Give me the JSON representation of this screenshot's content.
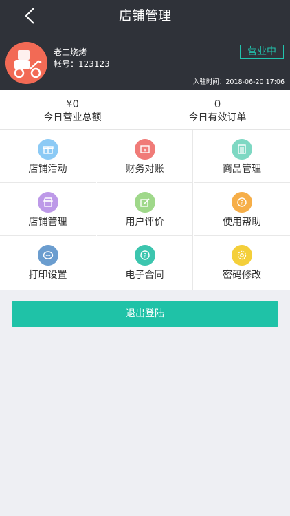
{
  "header": {
    "title": "店铺管理",
    "shop_name": "老三烧烤",
    "account": "帐号：123123",
    "status": "营业中",
    "join_time": "入驻时间：2018-06-20 17:06"
  },
  "stats": {
    "revenue_value": "¥0",
    "revenue_label": "今日营业总额",
    "orders_value": "0",
    "orders_label": "今日有效订单"
  },
  "menu": [
    {
      "label": "店铺活动",
      "icon": "gift-icon",
      "color": "#8ccaf5"
    },
    {
      "label": "财务对账",
      "icon": "finance-icon",
      "color": "#f07b78"
    },
    {
      "label": "商品管理",
      "icon": "list-icon",
      "color": "#7ed8c3"
    },
    {
      "label": "店铺管理",
      "icon": "store-icon",
      "color": "#bd99e8"
    },
    {
      "label": "用户评价",
      "icon": "edit-icon",
      "color": "#9fd88a"
    },
    {
      "label": "使用帮助",
      "icon": "question-icon",
      "color": "#f6ae48"
    },
    {
      "label": "打印设置",
      "icon": "chat-icon",
      "color": "#6b9dcf"
    },
    {
      "label": "电子合同",
      "icon": "question-icon",
      "color": "#3cc5ae"
    },
    {
      "label": "密码修改",
      "icon": "gear-icon",
      "color": "#f4cf3a"
    }
  ],
  "logout_label": "退出登陆",
  "colors": {
    "header_bg": "#2f3239",
    "accent": "#1fc2a7"
  }
}
